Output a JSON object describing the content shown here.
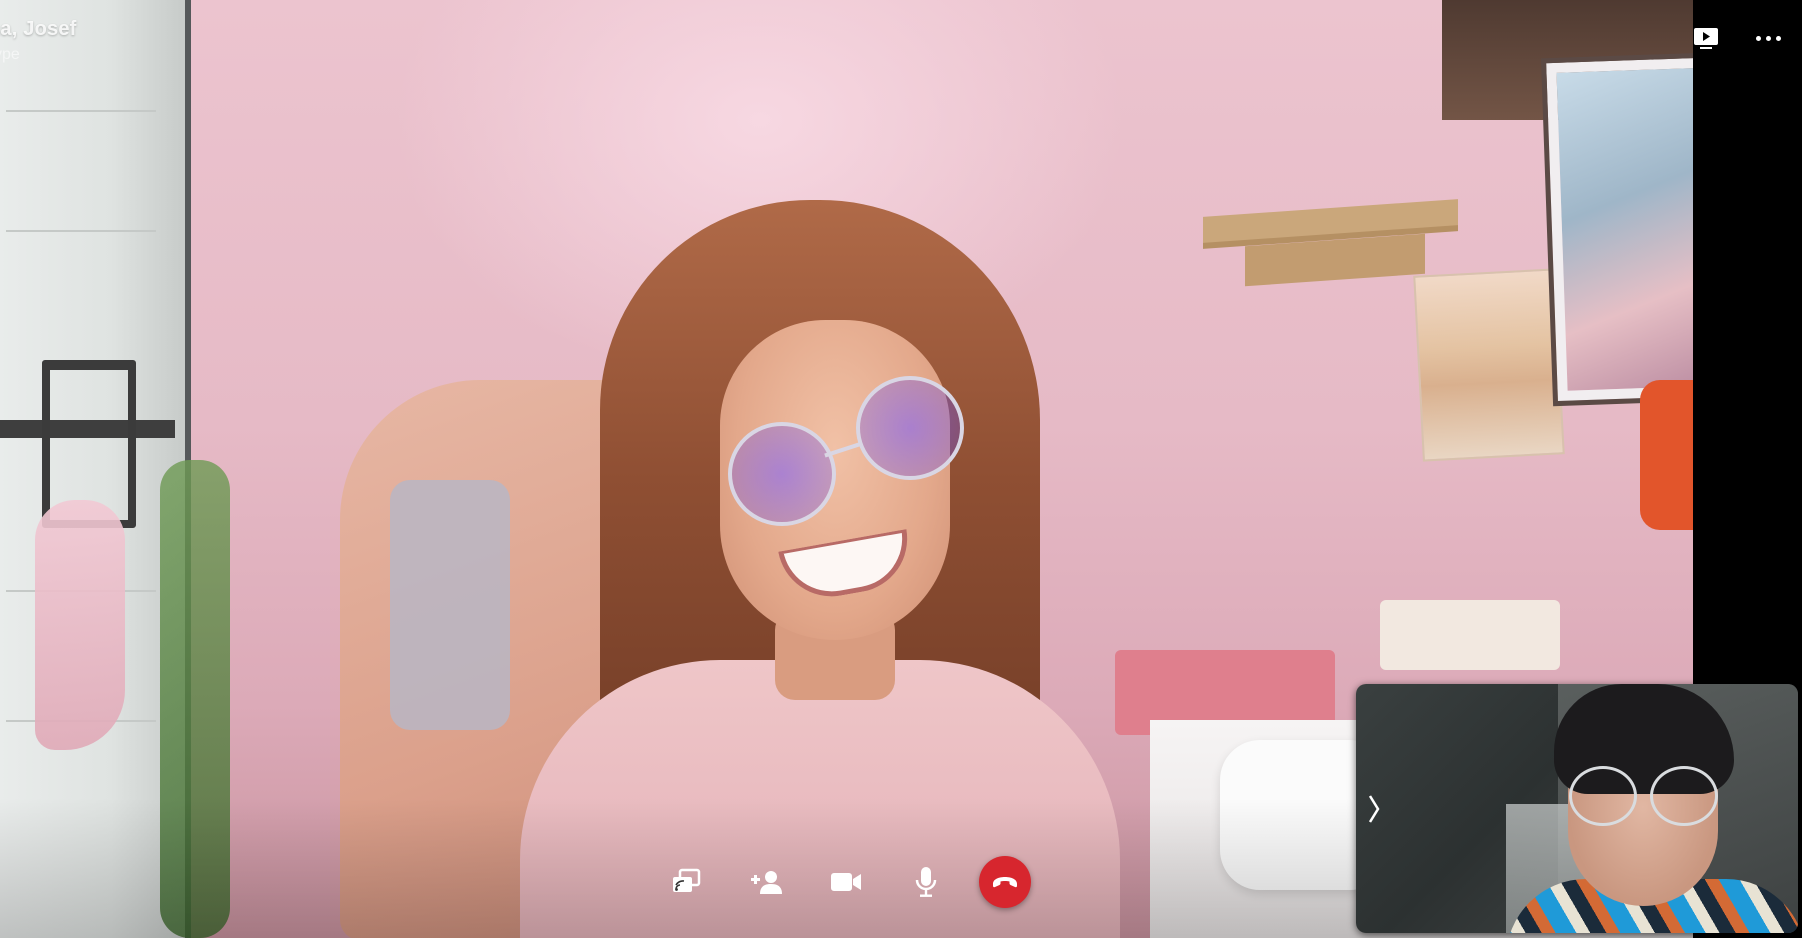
{
  "call": {
    "caller_name": "na, Josef",
    "caller_subtitle": "kype"
  },
  "top_controls": {
    "screen_icon": "video-screen-icon",
    "more_icon": "more-horizontal-icon"
  },
  "bottom_controls": [
    {
      "icon": "screen-share-icon"
    },
    {
      "icon": "add-participant-icon"
    },
    {
      "icon": "video-camera-icon"
    },
    {
      "icon": "microphone-icon"
    },
    {
      "icon": "end-call-icon"
    }
  ],
  "self_view": {
    "expand_icon": "chevron-right-icon"
  },
  "colors": {
    "hangup": "#d7262e",
    "icon": "#ffffff",
    "background": "#000000"
  }
}
